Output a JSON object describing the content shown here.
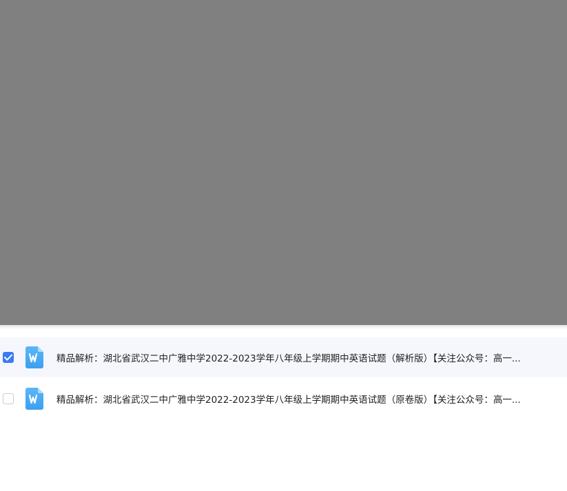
{
  "files": [
    {
      "name": "精品解析：湖北省武汉二中广雅中学2022-2023学年八年级上学期期中英语试题（解析版）【关注公众号：高一...",
      "checked": true,
      "icon": "word-doc-icon"
    },
    {
      "name": "精品解析：湖北省武汉二中广雅中学2022-2023学年八年级上学期期中英语试题（原卷版）【关注公众号：高一...",
      "checked": false,
      "icon": "word-doc-icon"
    }
  ],
  "colors": {
    "overlay": "#808080",
    "accent": "#3a7bf2",
    "selected_row": "#f5f7fc",
    "doc_icon": "#4aa8f2"
  }
}
